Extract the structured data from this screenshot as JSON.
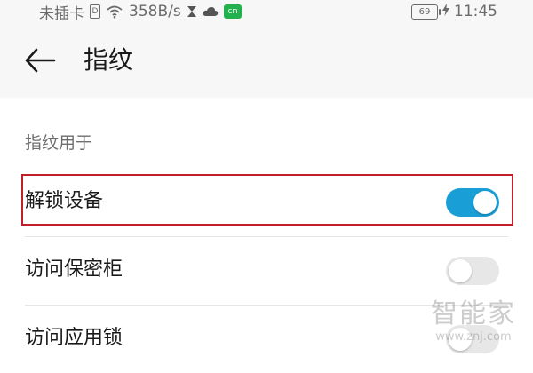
{
  "status_bar": {
    "carrier": "未插卡",
    "network_speed": "358B/s",
    "app_badge": "cm",
    "battery": "69",
    "time": "11:45"
  },
  "toolbar": {
    "title": "指纹"
  },
  "section": {
    "header": "指纹用于",
    "items": [
      {
        "label": "解锁设备",
        "enabled": true
      },
      {
        "label": "访问保密柜",
        "enabled": false
      },
      {
        "label": "访问应用锁",
        "enabled": false
      }
    ]
  },
  "watermark": {
    "brand": "智能家",
    "url": "www.znj.com"
  },
  "colors": {
    "toggle_on": "#1a9ed6",
    "toggle_off": "#e7e7e7",
    "highlight": "#c0202a",
    "header_bg": "#f7f7f7"
  }
}
